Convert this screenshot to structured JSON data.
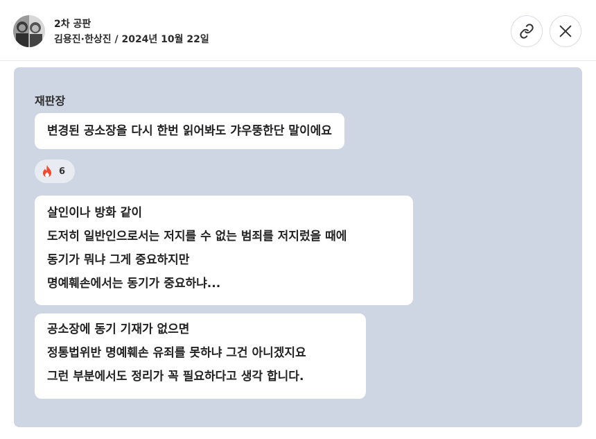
{
  "header": {
    "title": "2차 공판",
    "subtitle": "김용진·한상진 / 2024년 10월 22일"
  },
  "icons": {
    "link": "link-icon",
    "close": "close-icon",
    "reaction": "fire-icon"
  },
  "colors": {
    "panel_bg": "#cdd6e2",
    "bubble_bg": "#ffffff",
    "fire": "#f4462f"
  },
  "chat": {
    "speaker": "재판장",
    "messages": [
      {
        "lines": [
          "변경된 공소장을 다시 한번 읽어봐도 갸우뚱한단 말이에요"
        ]
      },
      {
        "lines": [
          "살인이나 방화 같이",
          "도저히 일반인으로서는 저지를 수 없는 범죄를 저지렀을 때에",
          "동기가 뭐냐 그게 중요하지만",
          "명예훼손에서는 동기가 중요하냐..."
        ]
      },
      {
        "lines": [
          "공소장에 동기 기재가 없으면",
          "정통법위반 명예훼손 유죄를 못하냐 그건 아니겠지요",
          "그런 부분에서도 정리가 꼭 필요하다고 생각 합니다."
        ]
      }
    ],
    "reaction": {
      "count": "6"
    }
  }
}
